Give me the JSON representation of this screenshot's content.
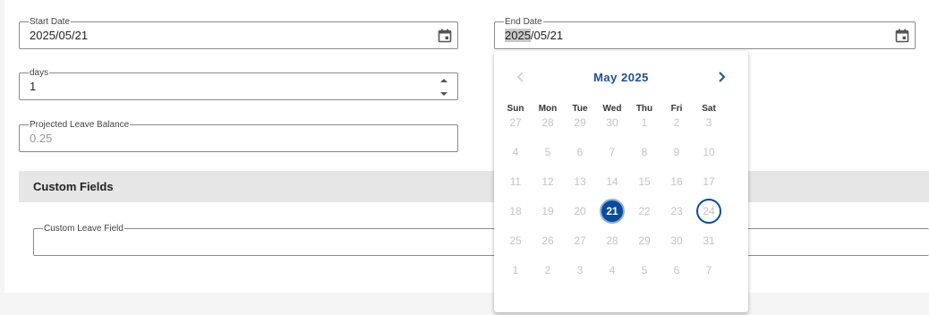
{
  "form": {
    "start_date": {
      "label": "Start Date",
      "value": "2025/05/21",
      "icon": "calendar-icon"
    },
    "end_date": {
      "label": "End Date",
      "value_selected": "2025",
      "value_rest": "/05/21",
      "icon": "calendar-icon"
    },
    "days": {
      "label": "days",
      "value": "1"
    },
    "projected_leave_balance": {
      "label": "Projected Leave Balance",
      "value": "0.25"
    }
  },
  "custom_fields": {
    "title": "Custom Fields",
    "custom_leave_field": {
      "label": "Custom Leave Field",
      "value": ""
    }
  },
  "calendar": {
    "month_title": "May 2025",
    "weekdays": [
      "Sun",
      "Mon",
      "Tue",
      "Wed",
      "Thu",
      "Fri",
      "Sat"
    ],
    "weeks": [
      [
        "27",
        "28",
        "29",
        "30",
        "1",
        "2",
        "3"
      ],
      [
        "4",
        "5",
        "6",
        "7",
        "8",
        "9",
        "10"
      ],
      [
        "11",
        "12",
        "13",
        "14",
        "15",
        "16",
        "17"
      ],
      [
        "18",
        "19",
        "20",
        "21",
        "22",
        "23",
        "24"
      ],
      [
        "25",
        "26",
        "27",
        "28",
        "29",
        "30",
        "31"
      ],
      [
        "1",
        "2",
        "3",
        "4",
        "5",
        "6",
        "7"
      ]
    ],
    "selected_day": "21",
    "today_day": "24",
    "prev_icon": "chevron-left-icon",
    "next_icon": "chevron-right-icon"
  },
  "colors": {
    "accent": "#0a4c9c",
    "disabled_day": "#c4c4c4",
    "section_bg": "#e6e6e6"
  }
}
